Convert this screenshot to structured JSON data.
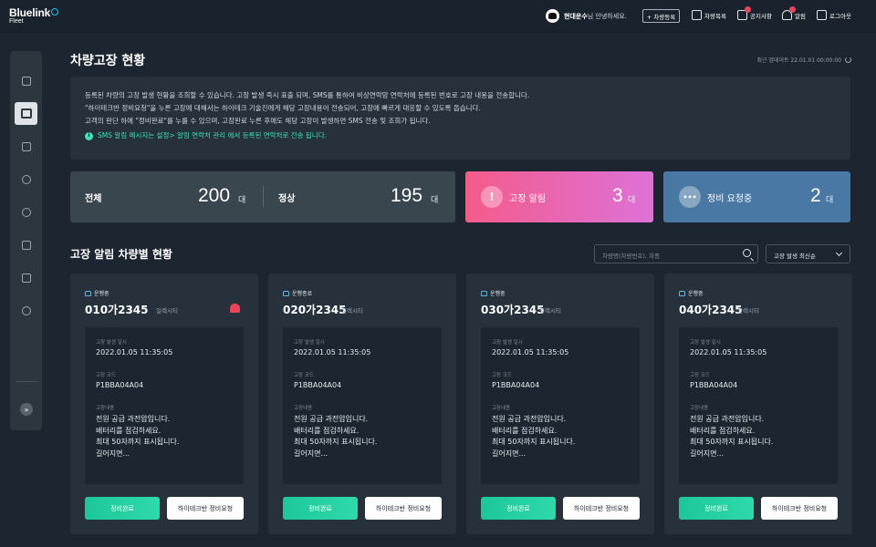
{
  "header": {
    "brand": "Bluelink",
    "brand_sub": "Fleet",
    "user_name": "현대운수",
    "greeting_suffix": "님 안녕하세요.",
    "register_button": "+ 차량등록",
    "nav": [
      {
        "label": "차량목록",
        "icon": "clipboard-icon",
        "badge": false
      },
      {
        "label": "공지사항",
        "icon": "megaphone-icon",
        "badge": true
      },
      {
        "label": "알림",
        "icon": "bell-icon",
        "badge": true
      },
      {
        "label": "로그아웃",
        "icon": "logout-icon",
        "badge": false
      }
    ]
  },
  "sidebar": {
    "items": [
      {
        "icon": "dashboard-icon",
        "active": false
      },
      {
        "icon": "vehicle-icon",
        "active": true
      },
      {
        "icon": "bar-chart-icon",
        "active": false
      },
      {
        "icon": "compass-icon",
        "active": false
      },
      {
        "icon": "location-icon",
        "active": false
      },
      {
        "icon": "document-icon",
        "active": false
      },
      {
        "icon": "download-icon",
        "active": false
      },
      {
        "icon": "settings-icon",
        "active": false
      }
    ],
    "expand_glyph": "»"
  },
  "page": {
    "title": "차량고장 현황",
    "updated": "최근 업데이트 22.01.01 00:00:00"
  },
  "notice": {
    "lines": [
      "등록된 차량의 고장 발생 현황을 조회할 수 있습니다. 고장 발생 즉시 표출 되며, SMS를 통하여 비상연락망 연락처에 등록된 번호로 고장 내용을 전송합니다.",
      "\"하이테크반 정비요청\"을 누른 고장에 대해서는 하이테크 기술진에게 해당 고장내용이 전송되어, 고장에 빠르게 대응할 수 있도록 돕습니다.",
      "고객의 판단 하에 \"정비완료\"를 누를 수 있으며, 고장완료 누른 후에도 해당 고장이 발생하면 SMS 전송 및 조회가 됩니다."
    ],
    "info": "SMS 알림 메시지는 설정> 알림 연락처 관리 에서 등록된 연락처로 전송 됩니다.",
    "info_icon": "i"
  },
  "stats": {
    "total_label": "전체",
    "total_value": "200",
    "total_unit": "대",
    "normal_label": "정상",
    "normal_value": "195",
    "normal_unit": "대",
    "alert_label": "고장 알림",
    "alert_value": "3",
    "alert_unit": "대",
    "alert_icon": "!",
    "repair_label": "정비 요청중",
    "repair_value": "2",
    "repair_unit": "대",
    "repair_icon": "•••"
  },
  "section": {
    "title": "고장 알림 차량별 현황",
    "search_placeholder": "차량명(차량번호), 차종",
    "sort_selected": "고장 발생 최신순"
  },
  "cards": [
    {
      "status": "운행중",
      "plate": "010가2345",
      "model": "일렉시티",
      "alarm": true,
      "date_label": "고장 발생 일시",
      "date": "2022.01.05 11:35:05",
      "code_label": "고장 코드",
      "code": "P1BBA04A04",
      "desc_label": "고장내용",
      "desc": [
        "전원 공급 과전압입니다.",
        "배터리를 점검하세요.",
        "최대 50자까지 표시됩니다.",
        "길어지면..."
      ],
      "btn_done": "정비완료",
      "btn_request": "하이테크반 정비요청"
    },
    {
      "status": "운행종료",
      "plate": "020가2345",
      "model": "일렉시티",
      "alarm": false,
      "date_label": "고장 발생 일시",
      "date": "2022.01.05 11:35:05",
      "code_label": "고장 코드",
      "code": "P1BBA04A04",
      "desc_label": "고장내용",
      "desc": [
        "전원 공급 과전압입니다.",
        "배터리를 점검하세요.",
        "최대 50자까지 표시됩니다.",
        "길어지면..."
      ],
      "btn_done": "정비완료",
      "btn_request": "하이테크반 정비요청"
    },
    {
      "status": "운행중",
      "plate": "030가2345",
      "model": "일렉시티",
      "alarm": false,
      "date_label": "고장 발생 일시",
      "date": "2022.01.05 11:35:05",
      "code_label": "고장 코드",
      "code": "P1BBA04A04",
      "desc_label": "고장내용",
      "desc": [
        "전원 공급 과전압입니다.",
        "배터리를 점검하세요.",
        "최대 50자까지 표시됩니다.",
        "길어지면..."
      ],
      "btn_done": "정비완료",
      "btn_request": "하이테크반 정비요청"
    },
    {
      "status": "운행중",
      "plate": "040가2345",
      "model": "일렉시티",
      "alarm": false,
      "date_label": "고장 발생 일시",
      "date": "2022.01.05 11:35:05",
      "code_label": "고장 코드",
      "code": "P1BBA04A04",
      "desc_label": "고장내용",
      "desc": [
        "전원 공급 과전압입니다.",
        "배터리를 점검하세요.",
        "최대 50자까지 표시됩니다.",
        "길어지면..."
      ],
      "btn_done": "정비완료",
      "btn_request": "하이테크반 정비요청"
    }
  ],
  "colors": {
    "background": "#1c2530",
    "panel": "#26313b",
    "accent_green": "#2fd9a8",
    "alert_gradient_start": "#f45b8a",
    "alert_gradient_end": "#dd72d8",
    "repair_blue": "#4a78a4",
    "badge_red": "#e8455c"
  }
}
